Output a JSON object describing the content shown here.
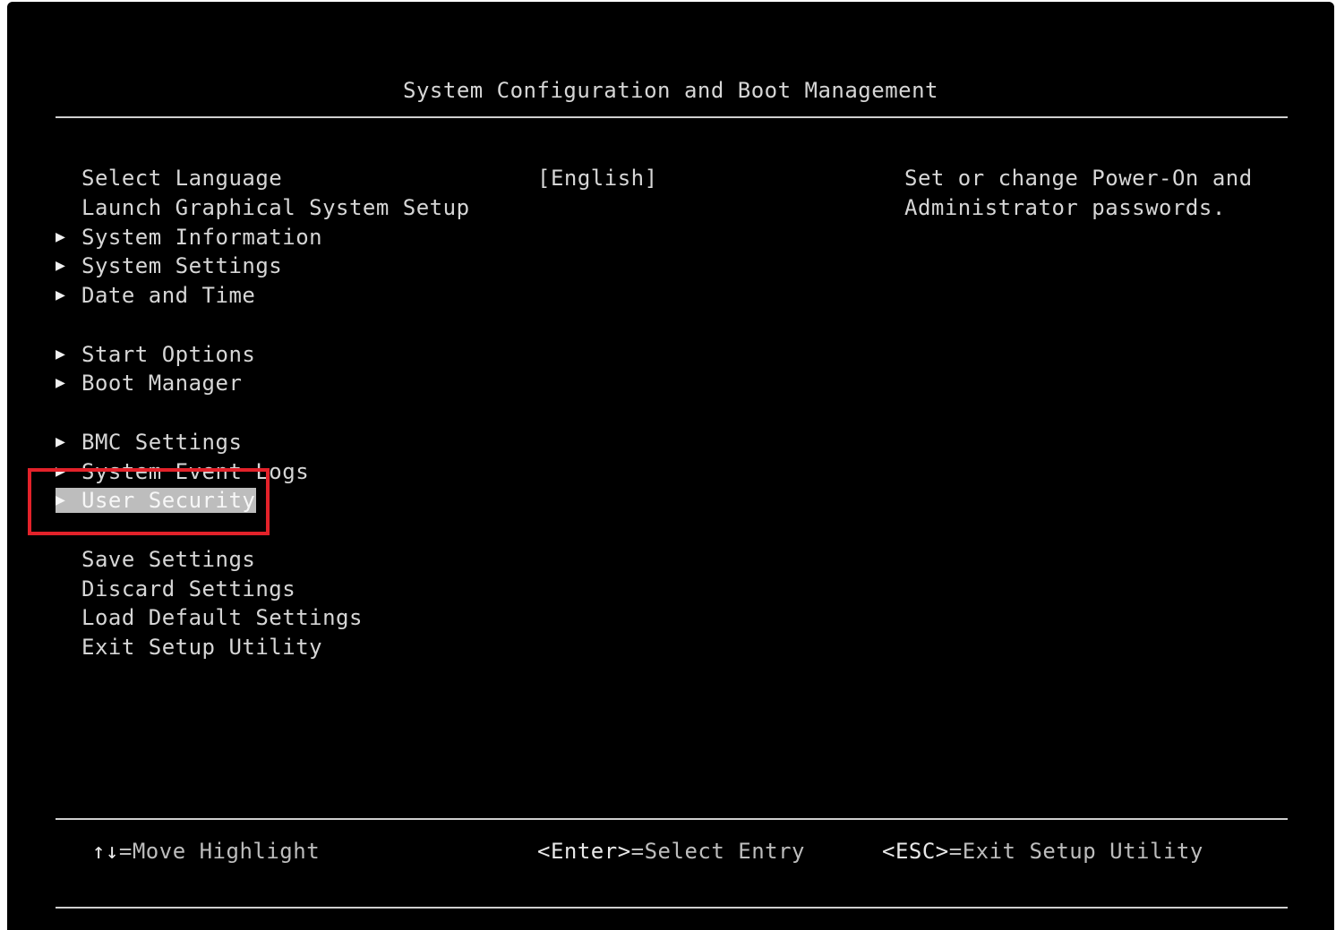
{
  "header": {
    "title": "System Configuration and Boot Management"
  },
  "menu": {
    "items": [
      {
        "label": "Select Language",
        "has_submenu": false
      },
      {
        "label": "Launch Graphical System Setup",
        "has_submenu": false
      },
      {
        "label": "System Information",
        "has_submenu": true
      },
      {
        "label": "System Settings",
        "has_submenu": true
      },
      {
        "label": "Date and Time",
        "has_submenu": true
      },
      {
        "label": "",
        "spacer": true
      },
      {
        "label": "Start Options",
        "has_submenu": true
      },
      {
        "label": "Boot Manager",
        "has_submenu": true
      },
      {
        "label": "",
        "spacer": true
      },
      {
        "label": "BMC Settings",
        "has_submenu": true
      },
      {
        "label": "System Event Logs",
        "has_submenu": true
      },
      {
        "label": "User Security",
        "has_submenu": true,
        "selected": true
      },
      {
        "label": "",
        "spacer": true
      },
      {
        "label": "Save Settings",
        "has_submenu": false
      },
      {
        "label": "Discard Settings",
        "has_submenu": false
      },
      {
        "label": "Load Default Settings",
        "has_submenu": false
      },
      {
        "label": "Exit Setup Utility",
        "has_submenu": false
      }
    ],
    "language_value": "[English]",
    "submenu_marker": "▶"
  },
  "help": {
    "line1": "Set or change Power-On and",
    "line2": "Administrator passwords."
  },
  "footer": {
    "move_key": "↑↓",
    "move_text": "=Move Highlight",
    "select_key": "<Enter>",
    "select_text": "=Select Entry",
    "exit_key": "<ESC>",
    "exit_text": "=Exit Setup Utility"
  },
  "colors": {
    "background": "#000000",
    "text": "#d6d6d6",
    "highlight": "#bdbdbd",
    "annotation": "#e3222a"
  },
  "annotation": {
    "target": "User Security"
  }
}
